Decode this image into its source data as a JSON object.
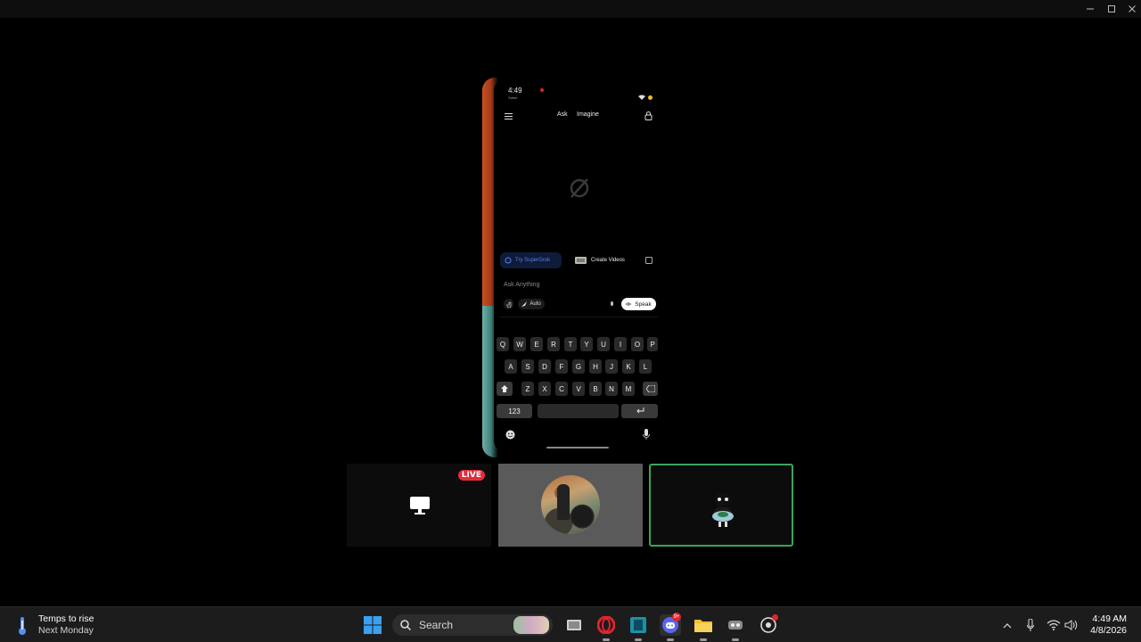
{
  "phone": {
    "status_time": "4:49",
    "status_sub": "Safari",
    "tabs": [
      "Ask",
      "Imagine"
    ],
    "chips": {
      "supergrok": "Try SuperGrok",
      "videos": "Create Videos"
    },
    "input_placeholder": "Ask Anything",
    "mode_label": "Auto",
    "speak_label": "Speak",
    "keyboard": {
      "row1": [
        "Q",
        "W",
        "E",
        "R",
        "T",
        "Y",
        "U",
        "I",
        "O",
        "P"
      ],
      "row2": [
        "A",
        "S",
        "D",
        "F",
        "G",
        "H",
        "J",
        "K",
        "L"
      ],
      "row3": [
        "Z",
        "X",
        "C",
        "V",
        "B",
        "N",
        "M"
      ],
      "numbers_key": "123"
    }
  },
  "tiles": {
    "live_label": "LIVE"
  },
  "taskbar": {
    "weather_title": "Temps to rise",
    "weather_subtitle": "Next Monday",
    "search_label": "Search",
    "discord_badge": "9+",
    "clock_time": "4:49 AM",
    "clock_date": "4/8/2026"
  },
  "colors": {
    "accent_live": "#e02d3c",
    "speaking_border": "#3ba55d",
    "taskbar_bg": "#1c1c1c"
  }
}
